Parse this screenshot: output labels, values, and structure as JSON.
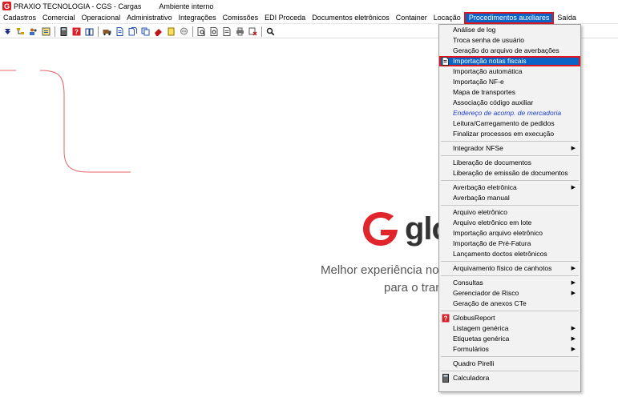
{
  "titlebar": {
    "title": "PRAXIO TECNOLOGIA - CGS - Cargas",
    "environment": "Ambiente interno"
  },
  "menubar": {
    "items": [
      {
        "label": "Cadastros"
      },
      {
        "label": "Comercial"
      },
      {
        "label": "Operacional"
      },
      {
        "label": "Administrativo"
      },
      {
        "label": "Integrações"
      },
      {
        "label": "Comissões"
      },
      {
        "label": "EDI Proceda"
      },
      {
        "label": "Documentos eletrônicos"
      },
      {
        "label": "Container"
      },
      {
        "label": "Locação"
      },
      {
        "label": "Procedimentos auxiliares"
      },
      {
        "label": "Saída"
      }
    ]
  },
  "colors": {
    "accent": "#0a64c8",
    "highlight_border": "#e0141e",
    "brand_red": "#e0252c"
  },
  "toolbar": {
    "icons": [
      "arrow-down-icon",
      "tree-icon",
      "users-icon",
      "report-icon",
      "calculator-icon",
      "help-icon",
      "book-icon",
      "truck-icon",
      "document-icon",
      "documents-icon",
      "copy-icon",
      "eraser-icon",
      "note-icon",
      "chat-icon",
      "preview-icon",
      "print-preview-icon",
      "print-list-icon",
      "print-icon",
      "stamp-icon",
      "search-icon"
    ]
  },
  "brand": {
    "word": "glo",
    "tagline_1": "Melhor experiência no",
    "tagline_2": "para o tran"
  },
  "dropdown": {
    "groups": [
      [
        {
          "label": "Análise de log"
        },
        {
          "label": "Troca senha de usuário"
        },
        {
          "label": "Geração do arquivo de averbações"
        },
        {
          "label": "Importação notas fiscais"
        },
        {
          "label": "Importação automática"
        },
        {
          "label": "Importação NF-e"
        },
        {
          "label": "Mapa de transportes"
        },
        {
          "label": "Associação código auxiliar"
        },
        {
          "label": "Endereço de acomp. de mercadoria"
        },
        {
          "label": "Leitura/Carregamento de pedidos"
        },
        {
          "label": "Finalizar processos em execução"
        }
      ],
      [
        {
          "label": "Integrador NFSe"
        }
      ],
      [
        {
          "label": "Liberação de documentos"
        },
        {
          "label": "Liberação de emissão de documentos"
        }
      ],
      [
        {
          "label": "Averbação eletrônica"
        },
        {
          "label": "Averbação manual"
        }
      ],
      [
        {
          "label": "Arquivo eletrônico"
        },
        {
          "label": "Arquivo eletrônico em lote"
        },
        {
          "label": "Importação arquivo eletrônico"
        },
        {
          "label": "Importação de Pré-Fatura"
        },
        {
          "label": "Lançamento doctos eletrônicos"
        }
      ],
      [
        {
          "label": "Arquivamento físico de canhotos"
        }
      ],
      [
        {
          "label": "Consultas"
        },
        {
          "label": "Gerenciador de Risco"
        },
        {
          "label": "Geração de anexos CTe"
        }
      ],
      [
        {
          "label": "GlobusReport"
        },
        {
          "label": "Listagem genérica"
        },
        {
          "label": "Etiquetas genérica"
        },
        {
          "label": "Formulários"
        }
      ],
      [
        {
          "label": "Quadro Pirelli"
        }
      ],
      [
        {
          "label": "Calculadora"
        }
      ]
    ]
  }
}
